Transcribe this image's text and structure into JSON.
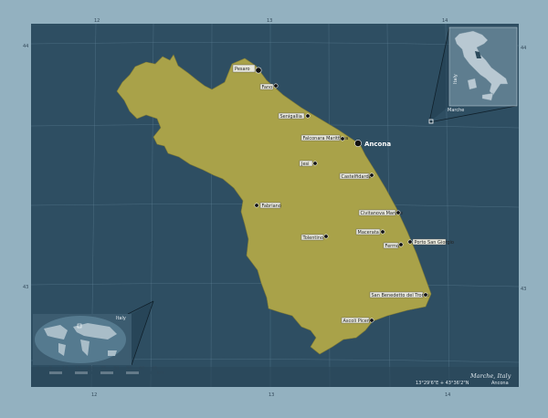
{
  "map": {
    "title": "Marche, Italy",
    "coordinates": "13°29'6\"E + 43°36'2\"N",
    "capital_ref": "Ancona",
    "region_color": "#a9a249",
    "background_color": "#2e4e62",
    "frame_color": "#93b1c0"
  },
  "grid_labels": {
    "top": [
      "12",
      "13",
      "14"
    ],
    "left": [
      "44",
      "43"
    ],
    "right": [
      "44",
      "43"
    ],
    "bottom": [
      "12",
      "13",
      "14"
    ]
  },
  "cities": [
    {
      "name": "Pesaro",
      "capital": false,
      "major": true
    },
    {
      "name": "Fano",
      "capital": false,
      "major": false
    },
    {
      "name": "Senigallia",
      "capital": false,
      "major": false
    },
    {
      "name": "Falconara Marittima",
      "capital": false,
      "major": false
    },
    {
      "name": "Ancona",
      "capital": true,
      "major": true
    },
    {
      "name": "Jesi",
      "capital": false,
      "major": false
    },
    {
      "name": "Castelfidardo",
      "capital": false,
      "major": false
    },
    {
      "name": "Fabriano",
      "capital": false,
      "major": false
    },
    {
      "name": "Civitanova Marche",
      "capital": false,
      "major": false
    },
    {
      "name": "Macerata",
      "capital": false,
      "major": false
    },
    {
      "name": "Tolentino",
      "capital": false,
      "major": false
    },
    {
      "name": "Fermo",
      "capital": false,
      "major": false
    },
    {
      "name": "Porto San Giorgio",
      "capital": false,
      "major": false
    },
    {
      "name": "San Benedetto del Tronto",
      "capital": false,
      "major": false
    },
    {
      "name": "Ascoli Piceno",
      "capital": false,
      "major": false
    }
  ],
  "inset_country": {
    "label": "Italy",
    "region_label": "Marche"
  },
  "inset_world": {
    "label": "Italy"
  },
  "scale": {
    "unit": "km",
    "ticks": [
      "0",
      "5",
      "10",
      "15",
      "20",
      "25",
      "30",
      "35",
      "40",
      "45"
    ]
  }
}
